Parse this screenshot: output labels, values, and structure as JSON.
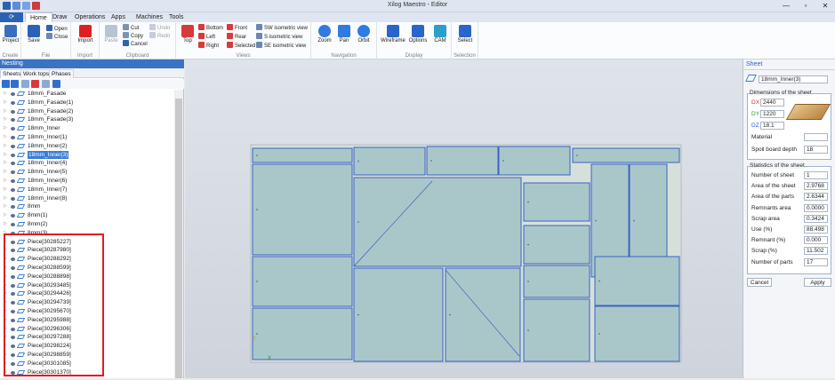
{
  "window": {
    "title": "Xilog Maestro - Editor",
    "controls": [
      "—",
      "▫",
      "✕"
    ]
  },
  "menu": {
    "file_label": "⟳",
    "tabs": [
      "Home",
      "Draw",
      "Operations",
      "Apps",
      "Machines",
      "Tools"
    ],
    "active_tab": "Home"
  },
  "ribbon": {
    "groups": {
      "create": "Create",
      "file": "File",
      "import": "Import",
      "clipboard": "Clipboard",
      "views": "Views",
      "navigation": "Navigation",
      "display": "Display",
      "selection": "Selection"
    },
    "buttons": {
      "project": "Project",
      "save": "Save",
      "open": "Open",
      "close": "Close",
      "import": "Import",
      "paste": "Paste",
      "cut": "Cut",
      "copy": "Copy",
      "cancel": "Cancel",
      "undo": "Undo",
      "redo": "Redo",
      "top": "Top",
      "bottom": "Bottom",
      "left": "Left",
      "right": "Right",
      "front": "Front",
      "rear": "Rear",
      "selected": "Selected",
      "sw_iso": "SW isometric view",
      "s_iso": "S isometric view",
      "se_iso": "SE isometric view",
      "zoom": "Zoom",
      "pan": "Pan",
      "orbit": "Orbit",
      "wireframe": "Wireframe",
      "options": "Options",
      "cam": "CAM",
      "select": "Select"
    }
  },
  "left_panel": {
    "header": "Nesting",
    "tabs": [
      "Sheets",
      "Work tops",
      "Phases"
    ],
    "items": [
      "18mm_Fasade",
      "18mm_Fasade(1)",
      "18mm_Fasade(2)",
      "18mm_Fasade(3)",
      "18mm_Inner",
      "18mm_Inner(1)",
      "18mm_Inner(2)",
      "18mm_Inner(3)",
      "18mm_Inner(4)",
      "18mm_Inner(5)",
      "18mm_Inner(6)",
      "18mm_Inner(7)",
      "18mm_Inner(8)",
      "8mm",
      "8mm(1)",
      "8mm(2)",
      "8mm(3)",
      "Piece[30285227]",
      "Piece[30287980]",
      "Piece[30288292]",
      "Piece[30288599]",
      "Piece[30288898]",
      "Piece[30293485]",
      "Piece[30294426]",
      "Piece[30294739]",
      "Piece[30295670]",
      "Piece[30295988]",
      "Piece[30296306]",
      "Piece[30297288]",
      "Piece[30298224]",
      "Piece[30298859]",
      "Piece[30301085]",
      "Piece[30301370]"
    ],
    "selected_index": 7
  },
  "right_panel": {
    "header": "Sheet",
    "sheet_name": "18mm_Inner(3)",
    "dimensions": {
      "title": "Dimensions of the sheet",
      "dx_label": "DX",
      "dx": "2440",
      "dy_label": "DY",
      "dy": "1220",
      "dz_label": "DZ",
      "dz": "18.1",
      "material_label": "Material",
      "material": "",
      "spoil_label": "Spoil board depth",
      "spoil": "18"
    },
    "statistics": {
      "title": "Statistics of the sheet",
      "rows": [
        {
          "label": "Number of sheet",
          "value": "1"
        },
        {
          "label": "Area of the sheet",
          "value": "2.9768"
        },
        {
          "label": "Area of the parts",
          "value": "2.6344"
        },
        {
          "label": "Remnants area",
          "value": "0.0000"
        },
        {
          "label": "Scrap area",
          "value": "0.3424"
        },
        {
          "label": "Use (%)",
          "value": "88.498"
        },
        {
          "label": "Remnant (%)",
          "value": "0.000"
        },
        {
          "label": "Scrap (%)",
          "value": "11.502"
        },
        {
          "label": "Number of parts",
          "value": "17"
        }
      ]
    },
    "cancel": "Cancel",
    "apply": "Apply"
  },
  "colors": {
    "accent": "#2c62b5",
    "part_fill": "#a9c7c9",
    "part_stroke": "#2f55c4",
    "highlight_box": "#e01b24"
  }
}
